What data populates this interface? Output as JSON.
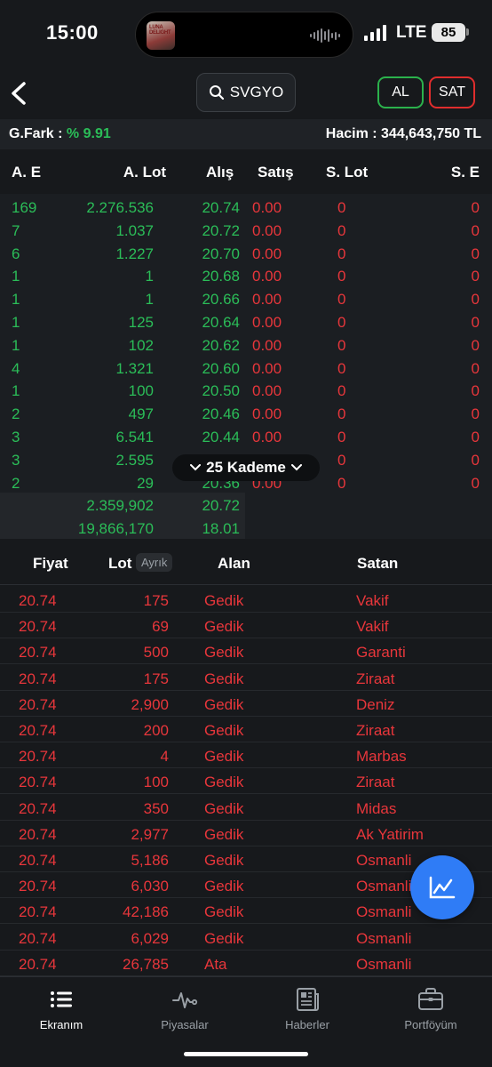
{
  "status": {
    "time": "15:00",
    "network": "LTE",
    "battery": "85",
    "island_thumb_text": "LUNA DELIGHT"
  },
  "header": {
    "search_text": "SVGYO",
    "buy_label": "AL",
    "sell_label": "SAT"
  },
  "summary": {
    "gfark_label": "G.Fark :",
    "gfark_value": "% 9.91",
    "hacim_label": "Hacim :",
    "hacim_value": "344,643,750 TL"
  },
  "depth": {
    "columns": [
      "A. E",
      "A. Lot",
      "Alış",
      "Satış",
      "S. Lot",
      "S. E"
    ],
    "rows": [
      {
        "ae": "169",
        "alot": "2.276.536",
        "alis": "20.74",
        "satis": "0.00",
        "slot": "0",
        "se": "0"
      },
      {
        "ae": "7",
        "alot": "1.037",
        "alis": "20.72",
        "satis": "0.00",
        "slot": "0",
        "se": "0"
      },
      {
        "ae": "6",
        "alot": "1.227",
        "alis": "20.70",
        "satis": "0.00",
        "slot": "0",
        "se": "0"
      },
      {
        "ae": "1",
        "alot": "1",
        "alis": "20.68",
        "satis": "0.00",
        "slot": "0",
        "se": "0"
      },
      {
        "ae": "1",
        "alot": "1",
        "alis": "20.66",
        "satis": "0.00",
        "slot": "0",
        "se": "0"
      },
      {
        "ae": "1",
        "alot": "125",
        "alis": "20.64",
        "satis": "0.00",
        "slot": "0",
        "se": "0"
      },
      {
        "ae": "1",
        "alot": "102",
        "alis": "20.62",
        "satis": "0.00",
        "slot": "0",
        "se": "0"
      },
      {
        "ae": "4",
        "alot": "1.321",
        "alis": "20.60",
        "satis": "0.00",
        "slot": "0",
        "se": "0"
      },
      {
        "ae": "1",
        "alot": "100",
        "alis": "20.50",
        "satis": "0.00",
        "slot": "0",
        "se": "0"
      },
      {
        "ae": "2",
        "alot": "497",
        "alis": "20.46",
        "satis": "0.00",
        "slot": "0",
        "se": "0"
      },
      {
        "ae": "3",
        "alot": "6.541",
        "alis": "20.44",
        "satis": "0.00",
        "slot": "0",
        "se": "0"
      },
      {
        "ae": "3",
        "alot": "2.595",
        "alis": "20.40",
        "satis": "0.00",
        "slot": "0",
        "se": "0"
      },
      {
        "ae": "2",
        "alot": "29",
        "alis": "20.36",
        "satis": "0.00",
        "slot": "0",
        "se": "0"
      }
    ],
    "totals": [
      {
        "alot": "2.359,902",
        "alis": "20.72"
      },
      {
        "alot": "19,866,170",
        "alis": "18.01"
      }
    ],
    "kademe_label": "25 Kademe"
  },
  "trades": {
    "headers": {
      "fiyat": "Fiyat",
      "lot": "Lot",
      "ayrik": "Ayrık",
      "alan": "Alan",
      "satan": "Satan"
    },
    "rows": [
      {
        "price": "20.74",
        "lot": "175",
        "alan": "Gedik",
        "satan": "Vakif"
      },
      {
        "price": "20.74",
        "lot": "69",
        "alan": "Gedik",
        "satan": "Vakif"
      },
      {
        "price": "20.74",
        "lot": "500",
        "alan": "Gedik",
        "satan": "Garanti"
      },
      {
        "price": "20.74",
        "lot": "175",
        "alan": "Gedik",
        "satan": "Ziraat"
      },
      {
        "price": "20.74",
        "lot": "2,900",
        "alan": "Gedik",
        "satan": "Deniz"
      },
      {
        "price": "20.74",
        "lot": "200",
        "alan": "Gedik",
        "satan": "Ziraat"
      },
      {
        "price": "20.74",
        "lot": "4",
        "alan": "Gedik",
        "satan": "Marbas"
      },
      {
        "price": "20.74",
        "lot": "100",
        "alan": "Gedik",
        "satan": "Ziraat"
      },
      {
        "price": "20.74",
        "lot": "350",
        "alan": "Gedik",
        "satan": "Midas"
      },
      {
        "price": "20.74",
        "lot": "2,977",
        "alan": "Gedik",
        "satan": "Ak Yatirim"
      },
      {
        "price": "20.74",
        "lot": "5,186",
        "alan": "Gedik",
        "satan": "Osmanli"
      },
      {
        "price": "20.74",
        "lot": "6,030",
        "alan": "Gedik",
        "satan": "Osmanli"
      },
      {
        "price": "20.74",
        "lot": "42,186",
        "alan": "Gedik",
        "satan": "Osmanli"
      },
      {
        "price": "20.74",
        "lot": "6,029",
        "alan": "Gedik",
        "satan": "Osmanli"
      },
      {
        "price": "20.74",
        "lot": "26,785",
        "alan": "Ata",
        "satan": "Osmanli"
      }
    ]
  },
  "tabs": [
    {
      "label": "Ekranım",
      "icon": "list-icon"
    },
    {
      "label": "Piyasalar",
      "icon": "pulse-icon"
    },
    {
      "label": "Haberler",
      "icon": "newspaper-icon"
    },
    {
      "label": "Portföyüm",
      "icon": "briefcase-icon"
    }
  ],
  "colors": {
    "positive": "#2bbd58",
    "negative": "#e8363b",
    "accent": "#2f7cf6",
    "background": "#17191c"
  }
}
